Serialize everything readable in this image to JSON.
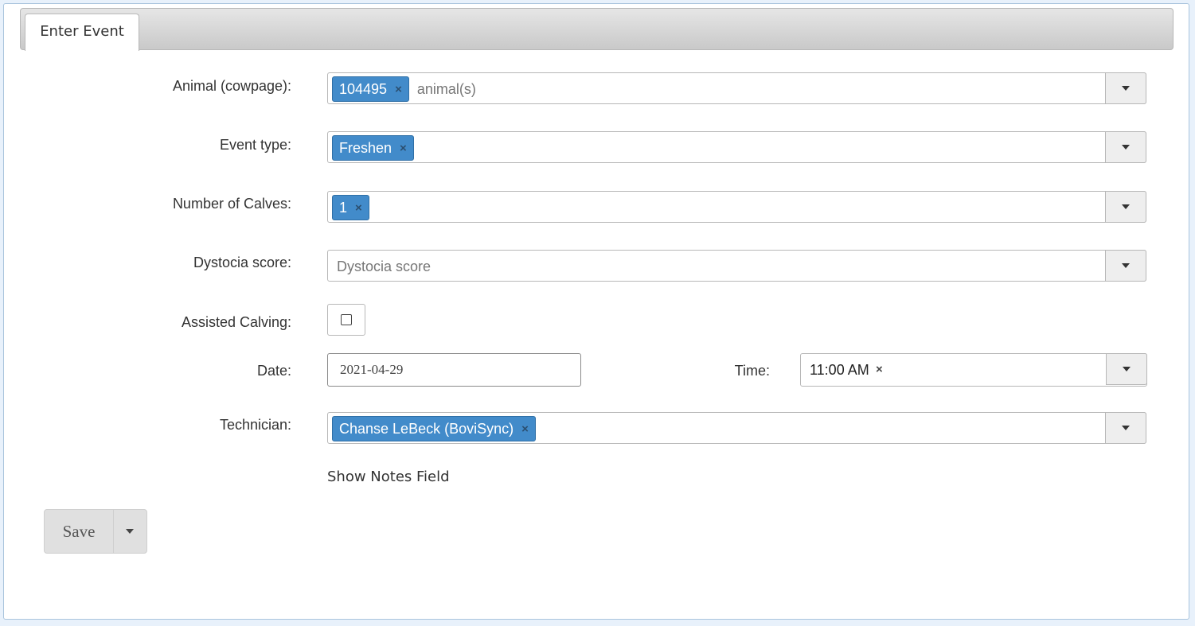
{
  "tab": {
    "label": "Enter Event"
  },
  "fields": {
    "animal": {
      "label": "Animal (cowpage):",
      "tags": [
        "104495"
      ],
      "placeholder": "animal(s)"
    },
    "event_type": {
      "label": "Event type:",
      "tags": [
        "Freshen"
      ]
    },
    "calves": {
      "label": "Number of Calves:",
      "tags": [
        "1"
      ]
    },
    "dystocia": {
      "label": "Dystocia score:",
      "placeholder": "Dystocia score"
    },
    "assisted": {
      "label": "Assisted Calving:",
      "checked": false
    },
    "date": {
      "label": "Date:",
      "value": "2021-04-29"
    },
    "time": {
      "label": "Time:",
      "value": "11:00 AM",
      "clear": "×"
    },
    "technician": {
      "label": "Technician:",
      "tags": [
        "Chanse LeBeck (BoviSync)"
      ]
    }
  },
  "tag_remove_glyph": "×",
  "notes_link": "Show Notes Field",
  "save": {
    "label": "Save"
  },
  "colors": {
    "tag_bg": "#428bca",
    "panel_border": "#a9c4dd",
    "page_bg": "#e8f1fb"
  }
}
